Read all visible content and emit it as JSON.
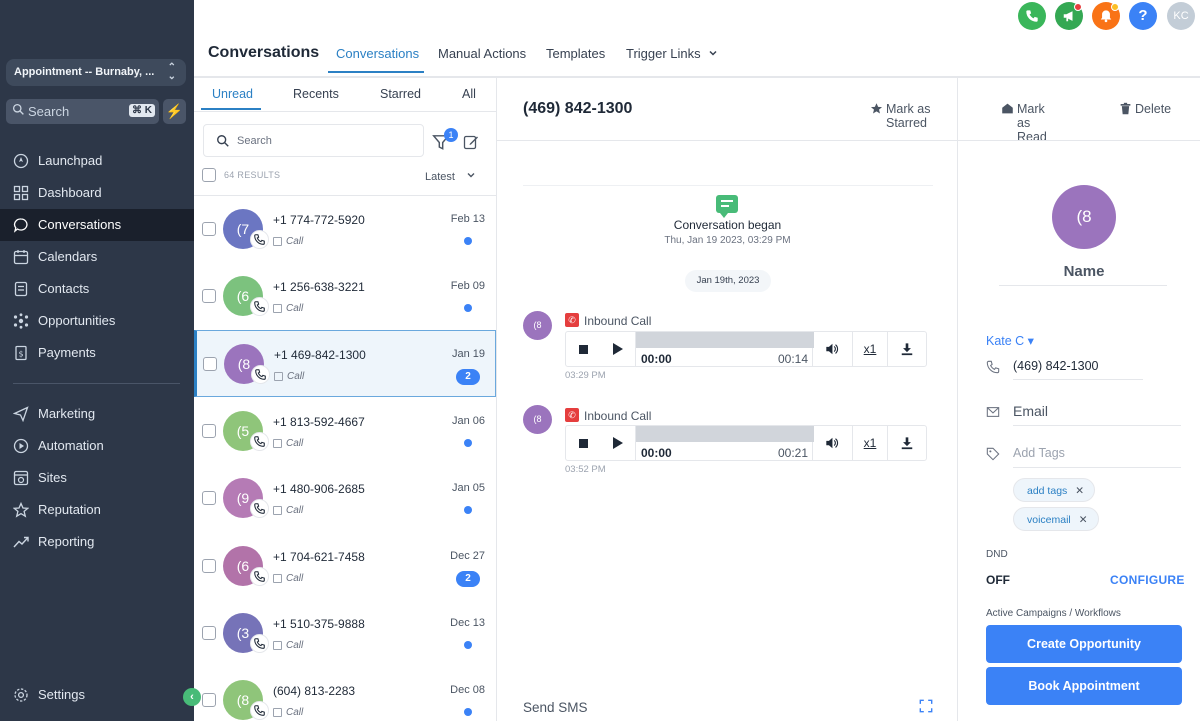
{
  "sidebar": {
    "location": "Appointment -- Burnaby, ...",
    "search_placeholder": "Search",
    "search_shortcut": "⌘ K",
    "nav_top": [
      {
        "label": "Launchpad",
        "icon": "rocket-icon"
      },
      {
        "label": "Dashboard",
        "icon": "grid-icon"
      },
      {
        "label": "Conversations",
        "icon": "chat-icon",
        "active": true
      },
      {
        "label": "Calendars",
        "icon": "calendar-icon"
      },
      {
        "label": "Contacts",
        "icon": "contacts-icon"
      },
      {
        "label": "Opportunities",
        "icon": "network-icon"
      },
      {
        "label": "Payments",
        "icon": "payments-icon"
      }
    ],
    "nav_bottom": [
      {
        "label": "Marketing",
        "icon": "send-icon"
      },
      {
        "label": "Automation",
        "icon": "automation-icon"
      },
      {
        "label": "Sites",
        "icon": "sites-icon"
      },
      {
        "label": "Reputation",
        "icon": "star-icon"
      },
      {
        "label": "Reporting",
        "icon": "trend-icon"
      }
    ],
    "settings_label": "Settings"
  },
  "header": {
    "title": "Conversations",
    "tabs": [
      {
        "label": "Conversations",
        "active": true
      },
      {
        "label": "Manual Actions"
      },
      {
        "label": "Templates"
      },
      {
        "label": "Trigger Links"
      }
    ],
    "user_initials": "KC",
    "colors": {
      "phone": "#3ab65a",
      "announce": "#34a853",
      "bell": "#f97316",
      "help": "#3b82f6"
    }
  },
  "list": {
    "tabs": [
      "Unread",
      "Recents",
      "Starred",
      "All"
    ],
    "search_placeholder": "Search",
    "filter_count": "1",
    "results": "64 RESULTS",
    "sort": "Latest",
    "rows": [
      {
        "initial": "(7",
        "name": "+1 774-772-5920",
        "type": "Call",
        "date": "Feb 13",
        "badge": "",
        "color": "#6b76c2"
      },
      {
        "initial": "(6",
        "name": "+1 256-638-3221",
        "type": "Call",
        "date": "Feb 09",
        "badge": "",
        "color": "#7cc27e"
      },
      {
        "initial": "(8",
        "name": "+1 469-842-1300",
        "type": "Call",
        "date": "Jan 19",
        "badge": "2",
        "color": "#9b74bd",
        "selected": true
      },
      {
        "initial": "(5",
        "name": "+1 813-592-4667",
        "type": "Call",
        "date": "Jan 06",
        "badge": "",
        "color": "#8fc57a"
      },
      {
        "initial": "(9",
        "name": "+1 480-906-2685",
        "type": "Call",
        "date": "Jan 05",
        "badge": "",
        "color": "#b57bb5"
      },
      {
        "initial": "(6",
        "name": "+1 704-621-7458",
        "type": "Call",
        "date": "Dec 27",
        "badge": "2",
        "color": "#b273a9"
      },
      {
        "initial": "(3",
        "name": "+1 510-375-9888",
        "type": "Call",
        "date": "Dec 13",
        "badge": "",
        "color": "#7673b8"
      },
      {
        "initial": "(8",
        "name": "(604) 813-2283",
        "type": "Call",
        "date": "Dec 08",
        "badge": "",
        "color": "#8fc57a"
      }
    ]
  },
  "chat": {
    "phone": "(469) 842-1300",
    "actions": [
      "Mark as Starred",
      "Mark as Read",
      "Delete"
    ],
    "began_title": "Conversation began",
    "began_time": "Thu, Jan 19 2023, 03:29 PM",
    "date_pill": "Jan 19th, 2023",
    "messages": [
      {
        "avatar": "(8",
        "title": "Inbound Call",
        "current": "00:00",
        "duration": "00:14",
        "speed": "x1",
        "time": "03:29 PM"
      },
      {
        "avatar": "(8",
        "title": "Inbound Call",
        "current": "00:00",
        "duration": "00:21",
        "speed": "x1",
        "time": "03:52 PM"
      }
    ],
    "composer_placeholder": "Send SMS"
  },
  "contact": {
    "avatar": "(8",
    "name": "Name",
    "owner": "Kate C ▾",
    "phone": "(469) 842-1300",
    "email_placeholder": "Email",
    "tags_placeholder": "Add Tags",
    "tags": [
      "add tags",
      "voicemail"
    ],
    "dnd_label": "DND",
    "dnd_value": "OFF",
    "configure": "CONFIGURE",
    "campaigns_label": "Active Campaigns / Workflows",
    "create_opportunity": "Create Opportunity",
    "book_appointment": "Book Appointment"
  }
}
